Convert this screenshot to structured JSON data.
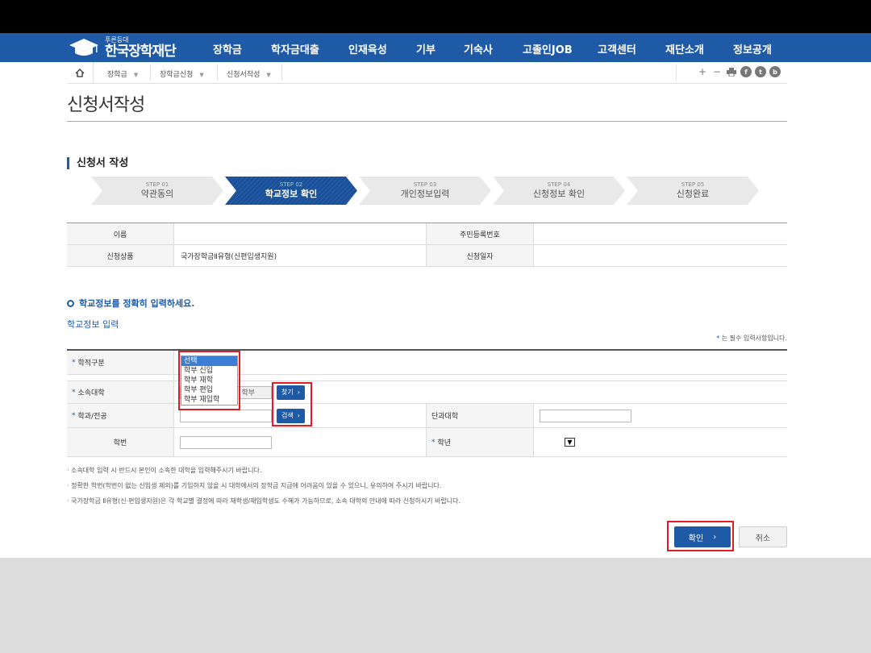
{
  "header": {
    "logo_small": "푸른등대",
    "logo_big": "한국장학재단",
    "menu": [
      "장학금",
      "학자금대출",
      "인재육성",
      "기부",
      "기숙사",
      "고졸인JOB",
      "고객센터",
      "재단소개",
      "정보공개"
    ]
  },
  "breadcrumb": {
    "home_icon": "home-icon",
    "items": [
      "장학금",
      "장학금신청",
      "신청서작성"
    ]
  },
  "tools": [
    "+",
    "−",
    "print-icon",
    "f",
    "t",
    "b"
  ],
  "page_title": "신청서작성",
  "section_title": "신청서 작성",
  "steps": [
    {
      "num": "STEP 01",
      "label": "약관동의",
      "active": false
    },
    {
      "num": "STEP 02",
      "label": "학교정보 확인",
      "active": true
    },
    {
      "num": "STEP 03",
      "label": "개인정보입력",
      "active": false
    },
    {
      "num": "STEP 04",
      "label": "신청정보 확인",
      "active": false
    },
    {
      "num": "STEP 05",
      "label": "신청완료",
      "active": false
    }
  ],
  "info_table": {
    "name_label": "이름",
    "name_value": "",
    "rrn_label": "주민등록번호",
    "rrn_value": "",
    "product_label": "신청상품",
    "product_value": "국가장학금Ⅱ유형(신편입생지원)",
    "date_label": "신청일자",
    "date_value": ""
  },
  "school_section": {
    "heading": "학교정보를 정확히 입력하세요.",
    "sub_link": "학교정보 입력",
    "required_note_star": "*",
    "required_note": "는 필수 입력사항입니다."
  },
  "form": {
    "status_label": "학적구분",
    "status_options": [
      "선택",
      "학부 신입",
      "학부 재학",
      "학부 편입",
      "학부 재입학"
    ],
    "status_selected": "선택",
    "university_label": "소속대학",
    "university_value_suffix": "학부",
    "search_btn1": "찾기",
    "major_label": "학과/전공",
    "search_btn2": "검색",
    "college_label": "단과대학",
    "student_id_label": "학번",
    "grade_label": "학년"
  },
  "notes": [
    "· 소속대학 입력 시 반드시 본인이 소속한 대학을 입력해주시기 바랍니다.",
    "· 정확한 학번(학번이 없는 신입생 제외)를 기입하지 않을 시 대학에서의 장학금 지급에 어려움이 있을 수 있으니, 유의하여 주시기 바랍니다.",
    "· 국가장학금 Ⅱ유형(신·편입생지원)은 각 학교별 결정에 따라 재학생/재입학생도 수혜가 가능하므로, 소속 대학의 안내에 따라 신청하시기 바랍니다."
  ],
  "buttons": {
    "confirm": "확인",
    "cancel": "취소"
  },
  "colors": {
    "brand_blue": "#1f5aa6",
    "highlight_red": "#e21b24"
  }
}
